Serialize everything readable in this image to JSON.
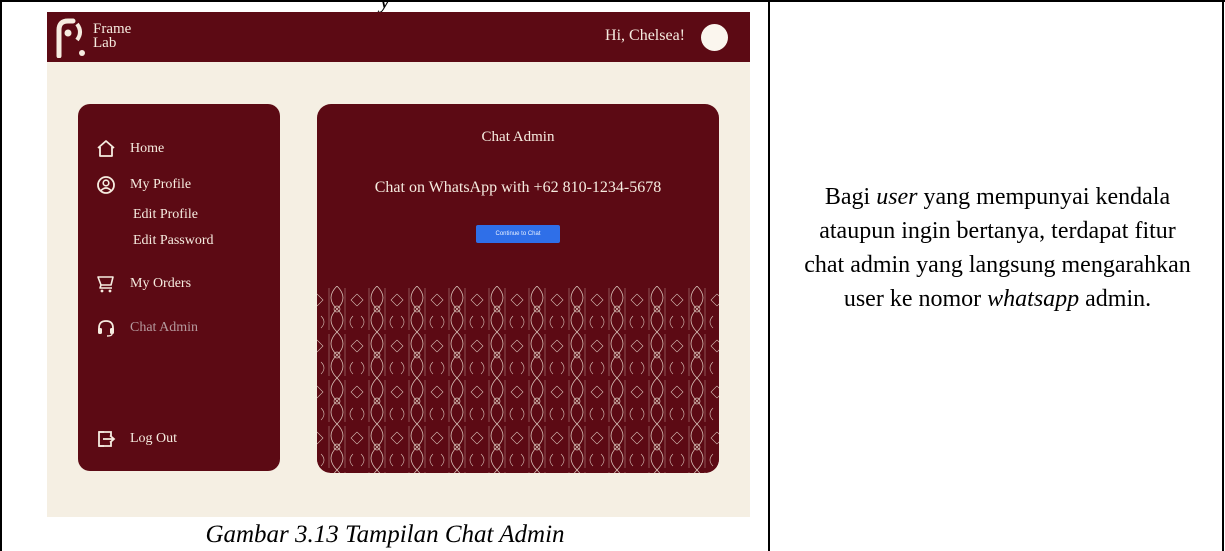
{
  "document": {
    "caption": "Gambar 3.13 Tampilan Chat Admin",
    "cut_heading": "y",
    "description_parts": [
      "Bagi ",
      "user",
      " yang mempunyai kendala ataupun ingin bertanya, terdapat fitur chat admin yang langsung mengarahkan user ke nomor ",
      "whatsapp",
      " admin."
    ]
  },
  "app": {
    "logo_text_line1": "Frame",
    "logo_text_line2": "Lab",
    "greeting": "Hi, Chelsea!",
    "sidebar": {
      "home": "Home",
      "my_profile": "My Profile",
      "edit_profile": "Edit Profile",
      "edit_password": "Edit Password",
      "my_orders": "My Orders",
      "chat_admin": "Chat Admin",
      "log_out": "Log Out"
    },
    "chat_panel": {
      "title": "Chat Admin",
      "description": "Chat on WhatsApp with +62 810-1234-5678",
      "button_label": "Continue to Chat"
    },
    "colors": {
      "primary": "#5c0a14",
      "background": "#f5efe3",
      "button": "#2f6fe8"
    },
    "icons": [
      "home-icon",
      "user-circle-icon",
      "cart-icon",
      "headset-icon",
      "logout-icon"
    ]
  }
}
